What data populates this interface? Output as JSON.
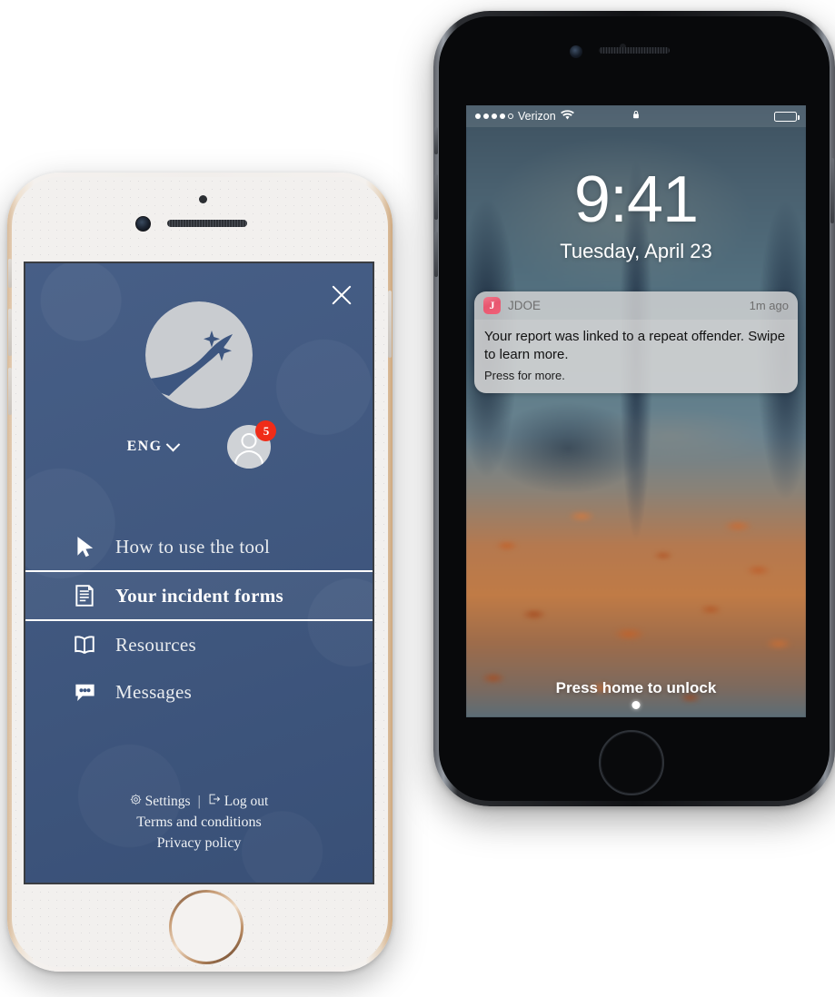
{
  "left_phone": {
    "device": "white-gold-iphone",
    "screen": {
      "background_color": "#3d5680",
      "close_button": {
        "icon": "close-icon",
        "label": "Close"
      },
      "logo": {
        "name": "brand-logo",
        "alt": "circle with winding path and stars"
      },
      "language": {
        "value": "ENG",
        "chevron": "chevron-down-icon"
      },
      "account": {
        "icon": "user-avatar-icon",
        "badge_count": "5",
        "badge_color": "#f02c18"
      },
      "nav_items": [
        {
          "label": "How to use the tool",
          "icon": "cursor-arrow-icon",
          "active": false
        },
        {
          "label": "Your incident forms",
          "icon": "document-lines-icon",
          "active": true
        },
        {
          "label": "Resources",
          "icon": "open-book-icon",
          "active": false
        },
        {
          "label": "Messages",
          "icon": "speech-bubble-icon",
          "active": false
        }
      ],
      "footer": {
        "settings_label": "Settings",
        "settings_icon": "gear-icon",
        "separator": "|",
        "logout_label": "Log out",
        "logout_icon": "logout-arrow-icon",
        "terms_label": "Terms and conditions",
        "privacy_label": "Privacy policy"
      }
    }
  },
  "right_phone": {
    "device": "black-iphone",
    "screen": {
      "statusbar": {
        "carrier": "Verizon",
        "signal_filled": 4,
        "signal_total": 5,
        "wifi_icon": "wifi-icon",
        "lock_icon": "lock-icon",
        "battery_icon": "battery-full-icon"
      },
      "clock": {
        "time": "9:41",
        "date": "Tuesday, April 23"
      },
      "notification": {
        "app_icon_letter": "J",
        "app_name": "JDOE",
        "time": "1m ago",
        "message": "Your report was linked to a repeat offender. Swipe to learn more.",
        "subtext": "Press for more."
      },
      "unlock_hint": "Press home to unlock"
    }
  }
}
